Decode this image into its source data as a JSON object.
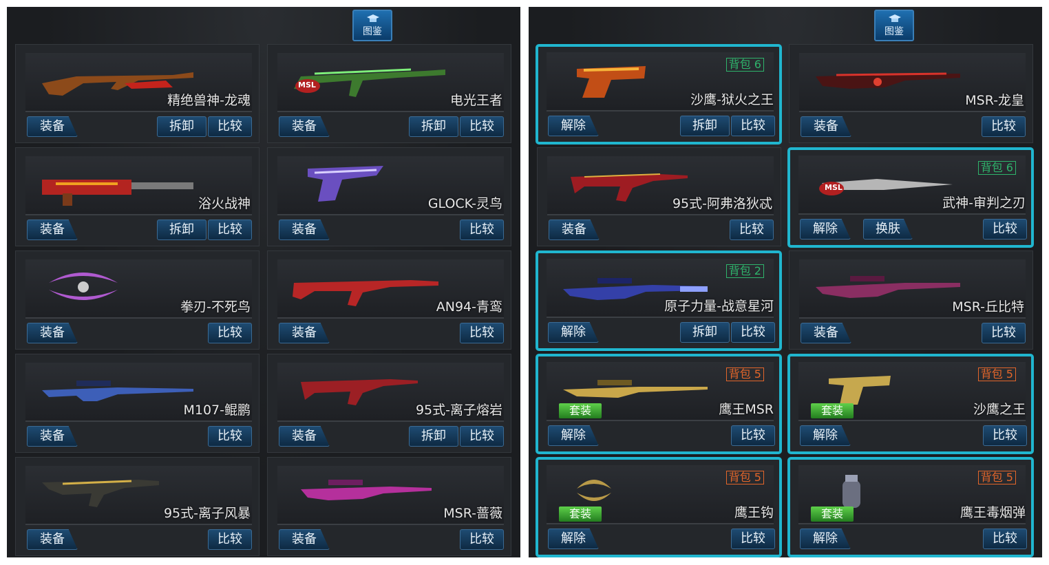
{
  "left_panel": {
    "tome_label": "图鉴",
    "cards": [
      {
        "name": "精绝兽神-龙魂",
        "btn_equip": "装备",
        "btn_disassemble": "拆卸",
        "btn_compare": "比较"
      },
      {
        "name": "电光王者",
        "btn_equip": "装备",
        "btn_disassemble": "拆卸",
        "btn_compare": "比较",
        "msl": "MSL"
      },
      {
        "name": "浴火战神",
        "btn_equip": "装备",
        "btn_disassemble": "拆卸",
        "btn_compare": "比较"
      },
      {
        "name": "GLOCK-灵鸟",
        "btn_equip": "装备",
        "btn_compare": "比较"
      },
      {
        "name": "拳刃-不死鸟",
        "btn_equip": "装备",
        "btn_compare": "比较"
      },
      {
        "name": "AN94-青鸾",
        "btn_equip": "装备",
        "btn_compare": "比较"
      },
      {
        "name": "M107-鲲鹏",
        "btn_equip": "装备",
        "btn_compare": "比较"
      },
      {
        "name": "95式-离子熔岩",
        "btn_equip": "装备",
        "btn_disassemble": "拆卸",
        "btn_compare": "比较"
      },
      {
        "name": "95式-离子风暴",
        "btn_equip": "装备",
        "btn_compare": "比较"
      },
      {
        "name": "MSR-蔷薇",
        "btn_equip": "装备",
        "btn_compare": "比较"
      }
    ]
  },
  "right_panel": {
    "tome_label": "图鉴",
    "cards": [
      {
        "name": "沙鹰-狱火之王",
        "btn_equip": "解除",
        "btn_disassemble": "拆卸",
        "btn_compare": "比较",
        "bag": "背包 6",
        "bag_color": "green",
        "selected": true
      },
      {
        "name": "MSR-龙皇",
        "btn_equip": "装备",
        "btn_compare": "比较"
      },
      {
        "name": "95式-阿弗洛狄忒",
        "btn_equip": "装备",
        "btn_compare": "比较"
      },
      {
        "name": "武神-审判之刃",
        "btn_equip": "解除",
        "btn_skin": "换肤",
        "btn_compare": "比较",
        "bag": "背包 6",
        "bag_color": "green",
        "selected": true,
        "msl": "MSL"
      },
      {
        "name": "原子力量-战意星河",
        "btn_equip": "解除",
        "btn_disassemble": "拆卸",
        "btn_compare": "比较",
        "bag": "背包 2",
        "bag_color": "green",
        "selected": true
      },
      {
        "name": "MSR-丘比特",
        "btn_equip": "装备",
        "btn_compare": "比较"
      },
      {
        "name": "鹰王MSR",
        "btn_equip": "解除",
        "btn_compare": "比较",
        "bag": "背包 5",
        "bag_color": "orange",
        "selected": true,
        "set": "套装"
      },
      {
        "name": "沙鹰之王",
        "btn_equip": "解除",
        "btn_compare": "比较",
        "bag": "背包 5",
        "bag_color": "orange",
        "selected": true,
        "set": "套装"
      },
      {
        "name": "鹰王钩",
        "btn_equip": "解除",
        "btn_compare": "比较",
        "bag": "背包 5",
        "bag_color": "orange",
        "selected": true,
        "set": "套装"
      },
      {
        "name": "鹰王毒烟弹",
        "btn_equip": "解除",
        "btn_compare": "比较",
        "bag": "背包 5",
        "bag_color": "orange",
        "selected": true,
        "set": "套装"
      }
    ]
  },
  "colors": {
    "accent_border": "#20b6cf",
    "bag_green": "#2fb56c",
    "bag_orange": "#e4662a",
    "button": "#1e4b72"
  }
}
